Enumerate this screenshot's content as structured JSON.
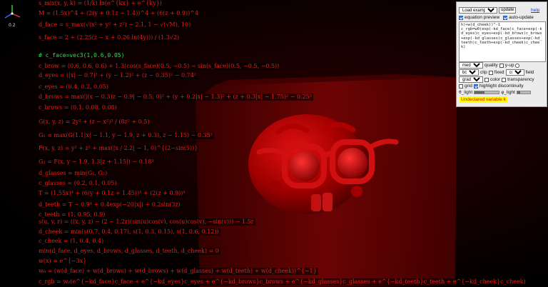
{
  "gizmo": {
    "value": "0.2"
  },
  "equations": [
    {
      "text": "s_mix(x, y, k) = (1/k) ln(e^{kx} + e^{ky})",
      "kind": "math"
    },
    {
      "text": "M = (1.5x)^4 + (2(y + 0.1z − 1.4))^4 + (6(z + 0.9))^4",
      "kind": "math"
    },
    {
      "text": "d_face = s_max(√(x² + y² + z²) − 2.1, 1 − √(√M), 10)",
      "kind": "math"
    },
    {
      "text": "s_face = 2 + (2.25(z − x + 0.26 ln(4y))) / (1.3√2)",
      "kind": "math"
    },
    {
      "text": "# c_face=vec3(1,0.6,0.05)",
      "kind": "comment"
    },
    {
      "text": "c_brow = (0.6, 0.6, 0.6) + 1.3(cos(s_face)(0.5, −0.5) − sin(s_face)(0.5, −0.5, −0.5))",
      "kind": "math"
    },
    {
      "text": "d_eyes = (|x| − 0.7)² + (y − 1.2)² + (z − 0.35)² − 0.74²",
      "kind": "math"
    },
    {
      "text": "c_eyes = (0.4, 0.2, 0.05)",
      "kind": "math"
    },
    {
      "text": "d_brows = max(|(x − 0.3)z − 0.9| − 0.5, 0)² + (y + 0.2|x| − 1.3)² + (z + 0.3|x| − 1.75)² − 0.25²",
      "kind": "math"
    },
    {
      "text": "c_brows = (0.1, 0.08, 0.08)",
      "kind": "math"
    },
    {
      "text": "G(x, y, z) = 2y² + (z − x²)² / (8z² + 0.5)",
      "kind": "math"
    },
    {
      "text": "G₁ = max(G(1.1|x| − 1.1, y − 1.9, z + 0.3), z − 1.15) − 0.35²",
      "kind": "math"
    },
    {
      "text": "F(x, y, z) = y² + z² + max(|x / 2.2| − 1, 0)^{(2−sin(5))}",
      "kind": "math"
    },
    {
      "text": "G₂ = F(x, y − 1.9, 1.3|z + 1.15|) − 0.18²",
      "kind": "math"
    },
    {
      "text": "d_glasses = min(G₁, G₂)",
      "kind": "math"
    },
    {
      "text": "c_glasses = (0.2, 0.1, 0.05)",
      "kind": "math"
    },
    {
      "text": "T = (1.55x)⁴ + (6(y + 0.1z + 1.45))⁴ + (2(z + 0.9))⁴",
      "kind": "math"
    },
    {
      "text": "d_teeth = T − 0.9⁴ + 0.4exp(−20|x|) + 0.2sin(3z)",
      "kind": "math"
    },
    {
      "text": "c_teeth = (1, 0.95, 0.9)",
      "kind": "math"
    },
    {
      "text": "s(u, v, r) = ((x, y, z) − (2 − 1.2r)(sin(u)cos(v), cos(u)cos(v), −sin(v))) − 1.5r",
      "kind": "math"
    },
    {
      "text": "d_cheek = min(s(0.7, 0.4, 0.17), s(1, 0.3, 0.15), s(1, 0.6, 0.12))",
      "kind": "math"
    },
    {
      "text": "c_cheek = (1, 0.4, 0.4)",
      "kind": "math"
    },
    {
      "text": "min(d_face, d_eyes, d_brows, d_glasses, d_teeth, d_cheek) = 0",
      "kind": "math"
    },
    {
      "text": "w(x) = e^{−3x}",
      "kind": "math"
    },
    {
      "text": "w₀ = (w(d_face) + w(d_brows) + w(d_brows) + w(d_glasses) + w(d_teeth) + w(d_cheek))^{−1}",
      "kind": "math"
    },
    {
      "text": "c_rgb = w₀(e^{−kd_face}c_face + e^{−kd_eyes}c_eyes + e^{−kd_brows}c_brows + e^{−kd_glasses}c_glasses + e^{−kd_teeth}c_teeth + e^{−kd_cheek}c_cheek)",
      "kind": "math"
    }
  ],
  "panel": {
    "load_example": "Load example...",
    "update_label": "update",
    "help_label": "help",
    "equation_preview_label": "equation preview",
    "auto_update_label": "auto-update",
    "code": "h)+w(d_cheek))^-1\nc_rgb=w0(exp(-kd_face)c_face+exp(-kd_eyes)c_eyes+exp(-kd_brows)c_brows+exp(-kd_glasses)c_glasses+exp(-kd_teeth)c_teeth+exp(-kd_cheek)c_cheek)",
    "quality_value": "medium",
    "quality_label": "quality",
    "yup_label": "y-up",
    "clip_value": "box",
    "clip_label": "clip",
    "fixed_label": "fixed",
    "field_value": "color",
    "field_label": "field",
    "shading_value": "gradient",
    "color_label": "color",
    "transparency_label": "transparency",
    "grid_label": "grid",
    "highlight_label": "highlight discontinuity",
    "theta_label": "θ_light",
    "phi_label": "φ_light",
    "theta_level": 0.4,
    "phi_level": 0.25,
    "error_text": "Undeclared variable k"
  },
  "colors": {
    "accent": "#e8201a",
    "comment": "#2fdc5a",
    "error_bg": "#ffff00"
  }
}
